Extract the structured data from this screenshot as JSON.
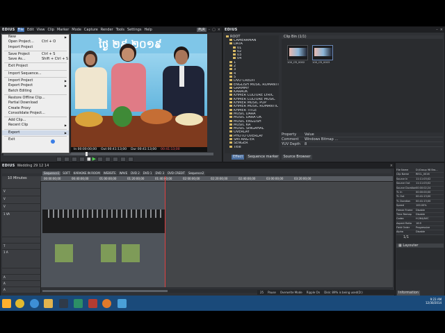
{
  "app": {
    "logo": "EDIUS",
    "menus": [
      "File",
      "Edit",
      "View",
      "Clip",
      "Marker",
      "Mode",
      "Capture",
      "Render",
      "Tools",
      "Settings",
      "Help"
    ],
    "active_menu": "File",
    "mode_badge": "PLR"
  },
  "file_menu": {
    "items": [
      {
        "label": "New",
        "shortcut": "",
        "arrow": true
      },
      {
        "label": "Open Project...",
        "shortcut": "Ctrl + O",
        "arrow": false
      },
      {
        "label": "Import Project",
        "shortcut": "",
        "arrow": false
      },
      {
        "sep": true
      },
      {
        "label": "Save Project",
        "shortcut": "Ctrl + S",
        "arrow": false
      },
      {
        "label": "Save As...",
        "shortcut": "Shift + Ctrl + S",
        "arrow": false
      },
      {
        "sep": true
      },
      {
        "label": "Exit Project",
        "shortcut": "",
        "arrow": false
      },
      {
        "sep": true
      },
      {
        "label": "Import Sequence...",
        "shortcut": "",
        "arrow": false
      },
      {
        "sep": true
      },
      {
        "label": "Import Project",
        "shortcut": "",
        "arrow": true
      },
      {
        "label": "Export Project",
        "shortcut": "",
        "arrow": true
      },
      {
        "label": "Batch Editing",
        "shortcut": "",
        "arrow": false
      },
      {
        "sep": true
      },
      {
        "label": "Restore Offline Clip...",
        "shortcut": "",
        "arrow": false
      },
      {
        "label": "Partial Download",
        "shortcut": "",
        "arrow": false
      },
      {
        "label": "Create Proxy",
        "shortcut": "",
        "arrow": false
      },
      {
        "label": "Consolidate Project...",
        "shortcut": "",
        "arrow": false
      },
      {
        "sep": true
      },
      {
        "label": "Add Clip...",
        "shortcut": "",
        "arrow": false
      },
      {
        "label": "Recent Clip",
        "shortcut": "",
        "arrow": true
      },
      {
        "sep": true
      },
      {
        "label": "Export",
        "shortcut": "",
        "arrow": true,
        "active": true
      },
      {
        "sep": true
      },
      {
        "label": "Exit",
        "shortcut": "",
        "arrow": false
      }
    ]
  },
  "preview": {
    "overlay_title": "ថ្ងៃ ២៩ ២០១៩",
    "timecode_in": "In 00:00:00;00",
    "timecode_out": "Out 00:41:13;00",
    "timecode_dur": "Dur 00:41:13;00",
    "timecode_current": "00:41:13;00"
  },
  "bin": {
    "logo": "EDIUS",
    "root_label": "ROOT",
    "header_label": "Clip Bin (1/1)",
    "tree": [
      {
        "label": "CAMERAMAN",
        "indent": 1
      },
      {
        "label": "DATA",
        "indent": 1
      },
      {
        "label": "01",
        "indent": 2
      },
      {
        "label": "02",
        "indent": 2
      },
      {
        "label": "03",
        "indent": 2
      },
      {
        "label": "04",
        "indent": 2
      },
      {
        "label": "1",
        "indent": 1
      },
      {
        "label": "2",
        "indent": 1
      },
      {
        "label": "3",
        "indent": 1
      },
      {
        "label": "4",
        "indent": 1
      },
      {
        "label": "5",
        "indent": 1
      },
      {
        "label": "DVD CREDIT",
        "indent": 1
      },
      {
        "label": "ENGLISH MUSIC ROMANTIC",
        "indent": 1
      },
      {
        "label": "GRAMMY",
        "indent": 1
      },
      {
        "label": "KARAOK",
        "indent": 1
      },
      {
        "label": "KHMER CULTURE LYRIC",
        "indent": 1
      },
      {
        "label": "KHMER CULTURE MUSIC",
        "indent": 1
      },
      {
        "label": "KHMER MUSIC POP",
        "indent": 1
      },
      {
        "label": "KHMER MUSIC ROMANTIC",
        "indent": 1
      },
      {
        "label": "KHMER TITLE",
        "indent": 1
      },
      {
        "label": "MUSIC DARA",
        "indent": 1
      },
      {
        "label": "MUSIC DARA OK",
        "indent": 1
      },
      {
        "label": "MUSIC ENGLISH",
        "indent": 1
      },
      {
        "label": "MUSIC KA",
        "indent": 1
      },
      {
        "label": "MUSIC SINGAHAL",
        "indent": 1
      },
      {
        "label": "OVERLAY",
        "indent": 1
      },
      {
        "label": "PHOTO OVERLAY",
        "indent": 1
      },
      {
        "label": "SMI ANG ER",
        "indent": 1
      },
      {
        "label": "SENGER",
        "indent": 1
      },
      {
        "label": "Title",
        "indent": 1
      }
    ],
    "thumbs": [
      {
        "label": "100_CR_0002"
      },
      {
        "label": "100_CR_0003"
      }
    ],
    "prop_header": {
      "k": "Property",
      "v": "Value"
    },
    "props": [
      {
        "k": "Comment",
        "v": "Windows Bitmap ..."
      },
      {
        "k": "YUV Depth",
        "v": "8"
      }
    ],
    "tabs": [
      "Effect",
      "Sequence marker",
      "Source Browser"
    ]
  },
  "timeline": {
    "logo": "EDIUS",
    "project_name": "Wedding 29 12 14",
    "seq_tabs": [
      "Sequence1",
      "SOFT",
      "KARAOKE IN ROOM",
      "WEBSITE",
      "WAVE",
      "DVD 2",
      "DVD 1",
      "DVD 3",
      "DVD CREDIT",
      "Sequence2"
    ],
    "ruler_times": [
      "00:00:00;00",
      "00:40:00;00",
      "01:00:00;00",
      "01:20:00;00",
      "01:40:00;00",
      "02:00:00;00",
      "02:20:00;00",
      "02:40:00;00",
      "03:00:00;00",
      "03:20:00;00"
    ],
    "track_labels": [
      "",
      "V",
      "V",
      "V",
      "1 VA",
      "",
      "T",
      "1 A",
      "",
      "A",
      "A",
      "A"
    ],
    "zoom_label": "10 Minutes"
  },
  "info_panel": {
    "rows": [
      {
        "k": "File Name",
        "v": "D:\\Group 98 Bro..."
      },
      {
        "k": "Clip Name",
        "v": "RECL_0016"
      },
      {
        "k": "Source In",
        "v": "11:11:03;02"
      },
      {
        "k": "Source Out",
        "v": "11:11:03;02"
      },
      {
        "k": "Source Duration",
        "v": "00:00:02;24"
      },
      {
        "k": "TL In",
        "v": "00:00:00;00"
      },
      {
        "k": "TL Out",
        "v": "00:41:13;00"
      },
      {
        "k": "TL Duration",
        "v": "00:41:13;00"
      },
      {
        "k": "Speed",
        "v": "100.00%"
      },
      {
        "k": "Freeze Frame",
        "v": "Disable"
      },
      {
        "k": "Time Remap",
        "v": "Disable"
      },
      {
        "k": "Codec",
        "v": "H.264/AVC"
      },
      {
        "k": "Aspect Ratio",
        "v": "16:9"
      },
      {
        "k": "Field Order",
        "v": "Progressive"
      },
      {
        "k": "Alpha",
        "v": "Disable"
      },
      {
        "k": "Macrovision",
        "v": "Disable"
      }
    ],
    "tab": "Information",
    "small_header": "1/1",
    "layer_label": "Layouter"
  },
  "status": {
    "items": [
      "25",
      "Pause",
      "Overwrite Mode",
      "Ripple On",
      "Disk: 89% is being used(D:)"
    ]
  },
  "taskbar": {
    "time": "9:23 AM",
    "date": "12/30/2014"
  }
}
